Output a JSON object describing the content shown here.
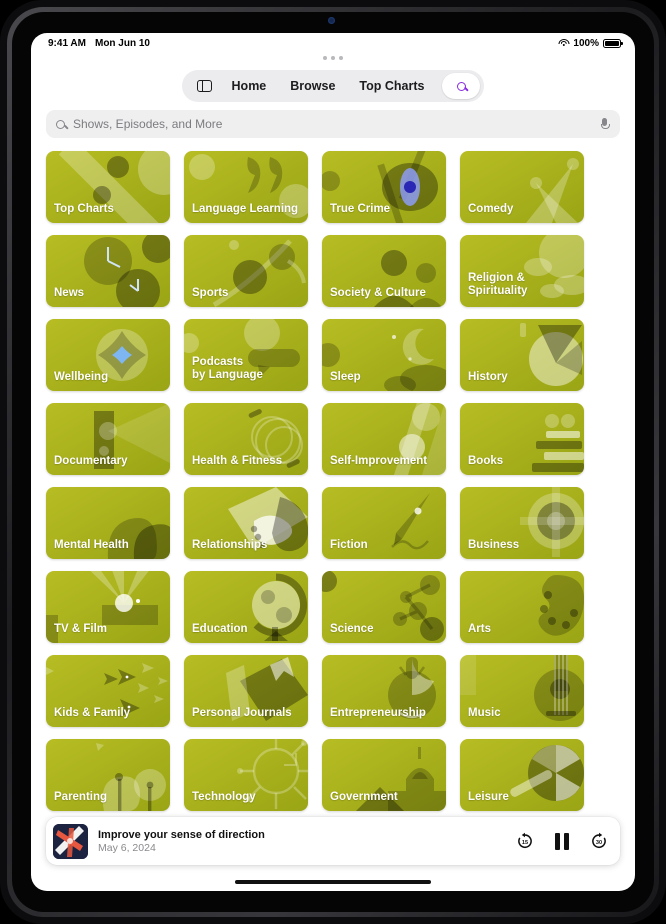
{
  "status_bar": {
    "time": "9:41 AM",
    "date": "Mon Jun 10",
    "battery": "100%",
    "wifi_icon": "wifi-icon",
    "battery_icon": "battery-icon"
  },
  "nav": {
    "sidebar_icon": "sidebar-toggle-icon",
    "items": [
      {
        "label": "Home"
      },
      {
        "label": "Browse"
      },
      {
        "label": "Top Charts"
      }
    ],
    "search_icon": "search-icon",
    "search_accent": "#8a2be2"
  },
  "search": {
    "placeholder": "Shows, Episodes, and More",
    "value": "",
    "icon": "search-icon",
    "mic_icon": "microphone-icon"
  },
  "categories": [
    {
      "label": "Top Charts",
      "color": "#9aa515",
      "color2": "#b7bd23",
      "art": "diag"
    },
    {
      "label": "Language Learning",
      "color": "#0f9b8e",
      "color2": "#17b3a0",
      "art": "quotes"
    },
    {
      "label": "True Crime",
      "color": "#4b49e8",
      "color2": "#5b57f2",
      "art": "eye"
    },
    {
      "label": "Comedy",
      "color": "#f0a020",
      "color2": "#f8b133",
      "art": "rays"
    },
    {
      "label": "News",
      "color": "#1f8fe0",
      "color2": "#3ba3ef",
      "art": "clocks"
    },
    {
      "label": "Sports",
      "color": "#5cb016",
      "color2": "#72c426",
      "art": "leaf"
    },
    {
      "label": "Society & Culture",
      "color": "#e8551f",
      "color2": "#f06a28",
      "art": "people"
    },
    {
      "label": "Religion & Spirituality",
      "color": "#0f8ec0",
      "color2": "#1ba3d4",
      "art": "clouds"
    },
    {
      "label": "Wellbeing",
      "color": "#2177e0",
      "color2": "#3a93f0",
      "art": "flower"
    },
    {
      "label": "Podcasts by Language",
      "color": "#10a08f",
      "color2": "#1cb8a2",
      "art": "bubbles"
    },
    {
      "label": "Sleep",
      "color": "#2d77d8",
      "color2": "#3e8ceb",
      "art": "moon"
    },
    {
      "label": "History",
      "color": "#ef8c14",
      "color2": "#f69b25",
      "art": "compass"
    },
    {
      "label": "Documentary",
      "color": "#ec6322",
      "color2": "#f2762f",
      "art": "projector"
    },
    {
      "label": "Health & Fitness",
      "color": "#1f7ae8",
      "color2": "#3291f5",
      "art": "rings"
    },
    {
      "label": "Self-Improvement",
      "color": "#0da07a",
      "color2": "#16b58b",
      "art": "ladder"
    },
    {
      "label": "Books",
      "color": "#e0425c",
      "color2": "#ec5169",
      "art": "stack"
    },
    {
      "label": "Mental Health",
      "color": "#2186e8",
      "color2": "#3a9cf5",
      "art": "heads"
    },
    {
      "label": "Relationships",
      "color": "#ef6a22",
      "color2": "#f57c2e",
      "art": "hands"
    },
    {
      "label": "Fiction",
      "color": "#d13fd1",
      "color2": "#e04ce0",
      "art": "pen"
    },
    {
      "label": "Business",
      "color": "#2566e8",
      "color2": "#3a7df5",
      "art": "target"
    },
    {
      "label": "TV & Film",
      "color": "#e8538c",
      "color2": "#f0659a",
      "art": "spotlight"
    },
    {
      "label": "Education",
      "color": "#0e9fa8",
      "color2": "#18b3ba",
      "art": "globe"
    },
    {
      "label": "Science",
      "color": "#3fa82a",
      "color2": "#4fbd36",
      "art": "molecule"
    },
    {
      "label": "Arts",
      "color": "#e24a4a",
      "color2": "#ec5a5a",
      "art": "palette"
    },
    {
      "label": "Kids & Family",
      "color": "#17a344",
      "color2": "#22b852",
      "art": "fish"
    },
    {
      "label": "Personal Journals",
      "color": "#ef6a1c",
      "color2": "#f57c2b",
      "art": "book"
    },
    {
      "label": "Entrepreneurship",
      "color": "#2f6ced",
      "color2": "#4180f5",
      "art": "bulb"
    },
    {
      "label": "Music",
      "color": "#e23c3c",
      "color2": "#ea4b4b",
      "art": "guitar"
    },
    {
      "label": "Parenting",
      "color": "#17a044",
      "color2": "#1fb351",
      "art": "trees"
    },
    {
      "label": "Technology",
      "color": "#3a53ef",
      "color2": "#4a68f7",
      "art": "circuit"
    },
    {
      "label": "Government",
      "color": "#cfa518",
      "color2": "#ddb423",
      "art": "capitol"
    },
    {
      "label": "Leisure",
      "color": "#e8399b",
      "color2": "#ef4ca8",
      "art": "umbrella"
    }
  ],
  "player": {
    "artwork_name": "episode-artwork",
    "title": "Improve your sense of direction",
    "date": "May 6, 2024",
    "skip_back_label": "15",
    "skip_forward_label": "30",
    "skip_back_icon": "skip-back-15-icon",
    "play_pause_icon": "pause-icon",
    "skip_forward_icon": "skip-forward-30-icon"
  }
}
